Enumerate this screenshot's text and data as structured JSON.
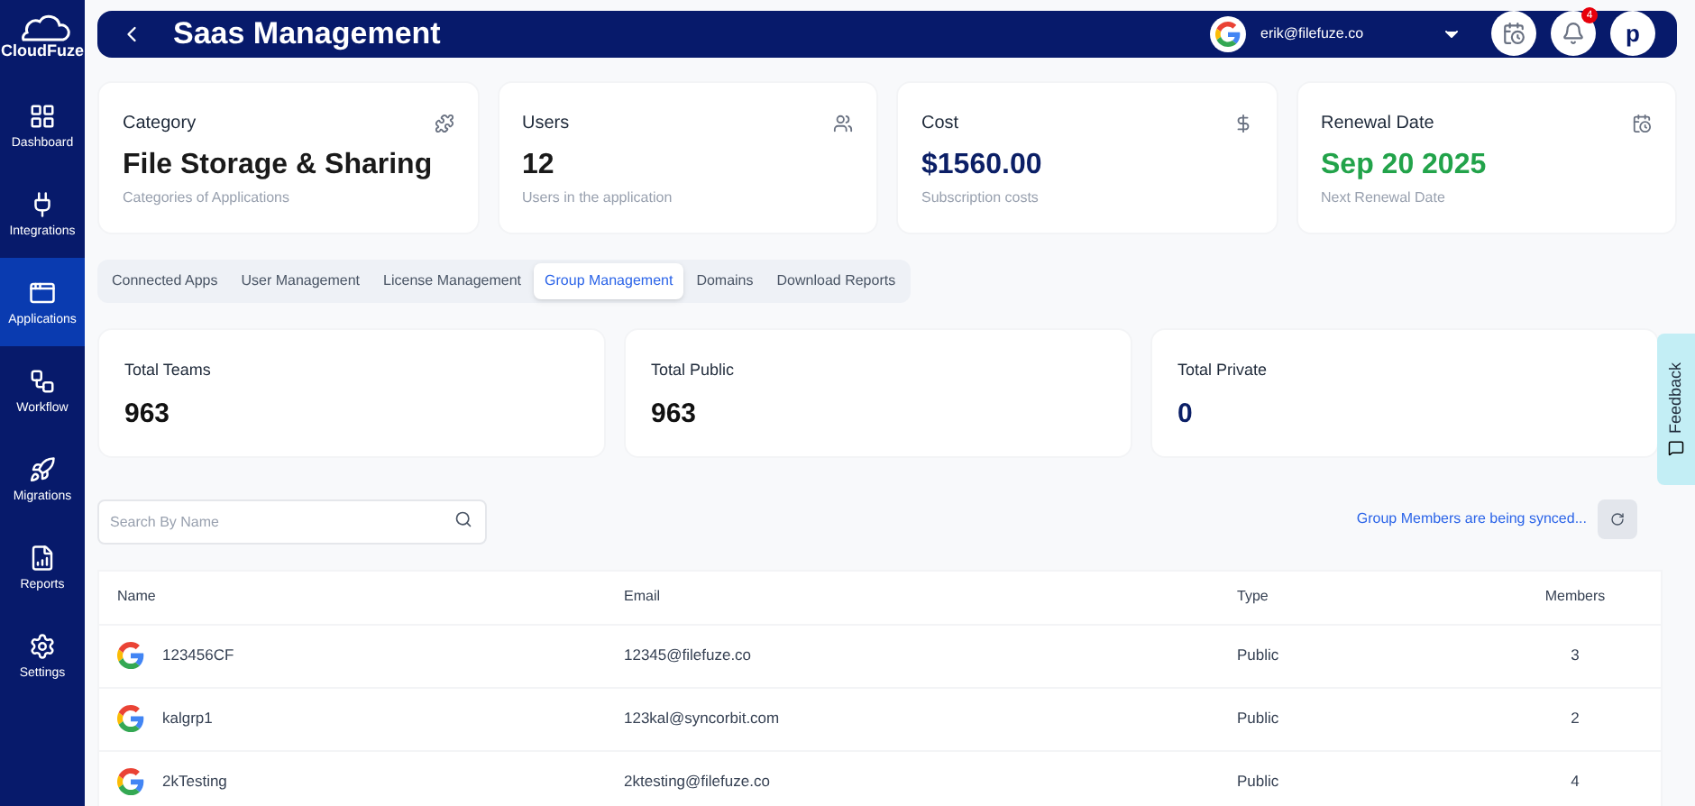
{
  "sidebar": {
    "logo": "CloudFuze",
    "items": [
      {
        "label": "Dashboard",
        "selected": false
      },
      {
        "label": "Integrations",
        "selected": false
      },
      {
        "label": "Applications",
        "selected": true
      },
      {
        "label": "Workflow",
        "selected": false
      },
      {
        "label": "Migrations",
        "selected": false
      },
      {
        "label": "Reports",
        "selected": false
      },
      {
        "label": "Settings",
        "selected": false
      }
    ]
  },
  "header": {
    "title": "Saas Management",
    "account": "erik@filefuze.co",
    "notification_count": "4",
    "avatar": "p"
  },
  "summary_cards": [
    {
      "title": "Category",
      "value": "File Storage & Sharing",
      "caption": "Categories of Applications",
      "color": "#1a1a1a"
    },
    {
      "title": "Users",
      "value": "12",
      "caption": "Users in the application",
      "color": "#1a1a1a"
    },
    {
      "title": "Cost",
      "value": "$1560.00",
      "caption": "Subscription costs",
      "color": "#0b1f66"
    },
    {
      "title": "Renewal Date",
      "value": "Sep 20 2025",
      "caption": "Next Renewal Date",
      "color": "#22a34a"
    }
  ],
  "tabs": [
    {
      "label": "Connected Apps",
      "selected": false
    },
    {
      "label": "User Management",
      "selected": false
    },
    {
      "label": "License Management",
      "selected": false
    },
    {
      "label": "Group Management",
      "selected": true
    },
    {
      "label": "Domains",
      "selected": false
    },
    {
      "label": "Download Reports",
      "selected": false
    }
  ],
  "totals": [
    {
      "title": "Total Teams",
      "value": "963",
      "color": "#111111"
    },
    {
      "title": "Total Public",
      "value": "963",
      "color": "#111111"
    },
    {
      "title": "Total Private",
      "value": "0",
      "color": "#0b1f66"
    }
  ],
  "search": {
    "placeholder": "Search By Name"
  },
  "sync_status": "Group Members are being synced...",
  "table": {
    "columns": [
      "Name",
      "Email",
      "Type",
      "Members"
    ],
    "rows": [
      {
        "name": "123456CF",
        "email": "12345@filefuze.co",
        "type": "Public",
        "members": "3"
      },
      {
        "name": "kalgrp1",
        "email": "123kal@syncorbit.com",
        "type": "Public",
        "members": "2"
      },
      {
        "name": "2kTesting",
        "email": "2ktesting@filefuze.co",
        "type": "Public",
        "members": "4"
      }
    ]
  },
  "feedback": "Feedback"
}
